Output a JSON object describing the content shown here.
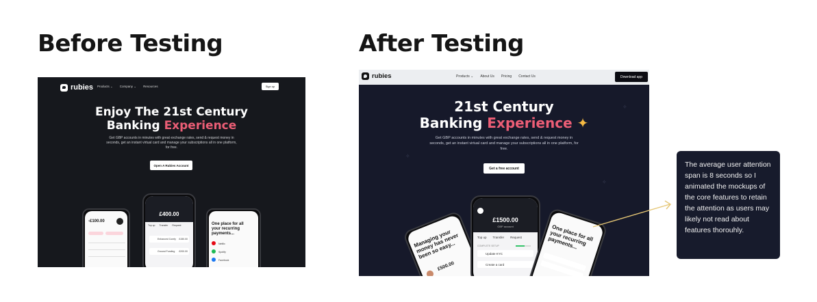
{
  "headings": {
    "before": "Before Testing",
    "after": "After Testing"
  },
  "before": {
    "logo": "rubies",
    "nav": [
      "Products ⌄",
      "Company ⌄",
      "Resources"
    ],
    "signup": "Sign up",
    "title_line1": "Enjoy The 21st Century",
    "title_line2_plain": "Banking ",
    "title_line2_accent": "Experience",
    "subtitle": "Get GBP accounts in minutes with great exchange rates, send & request money in seconds, get an instant virtual card and manage your subscriptions all in one platform, for free.",
    "cta": "Open A Rubies Account",
    "phone_left": {
      "amount": "-£100.00"
    },
    "phone_center": {
      "amount": "£400.00",
      "tabs": [
        "Top up",
        "Transfer",
        "Request"
      ],
      "rows": [
        "Enhanced Comfy",
        "Ground Funding"
      ],
      "row_amounts": [
        "£150.00",
        "£200.00"
      ]
    },
    "phone_right": {
      "headline": "One place for all your recurring payments...",
      "rows": [
        "Netflix",
        "Spotify",
        "Facebook"
      ]
    }
  },
  "after": {
    "logo": "rubies",
    "nav": [
      "Products ⌄",
      "About Us",
      "Pricing",
      "Contact Us"
    ],
    "download": "Download app",
    "title_line1": "21st Century",
    "title_line2_plain": "Banking ",
    "title_line2_accent": "Experience",
    "title_sparkle": "✦",
    "subtitle": "Get GBP accounts in minutes with great exchange rates, send & request money in seconds, get an instant virtual card and manage your subscriptions all in one platform, for free.",
    "cta": "Get a free account",
    "phone_left": {
      "headline": "Managing your money has never been so easy...",
      "amount": "£500.00"
    },
    "phone_center": {
      "amount": "£1500.00",
      "sub": "GBP account",
      "tabs": [
        "Top up",
        "Transfer",
        "Request"
      ],
      "section": "COMPLETE SETUP",
      "rows": [
        "Update KYC",
        "Create a card"
      ]
    },
    "phone_right": {
      "headline": "One place for all your recurring payments..."
    }
  },
  "note": "The average user attention span is 8 seconds so I animated the mockups of the core features to retain the attention as users may likely not read about features thorouhly.",
  "colors": {
    "accent": "#ec5e76",
    "dark_bg": "#16181d",
    "after_bg": "#16192a",
    "arrow": "#e5c675",
    "sparkle": "#f5b942"
  }
}
